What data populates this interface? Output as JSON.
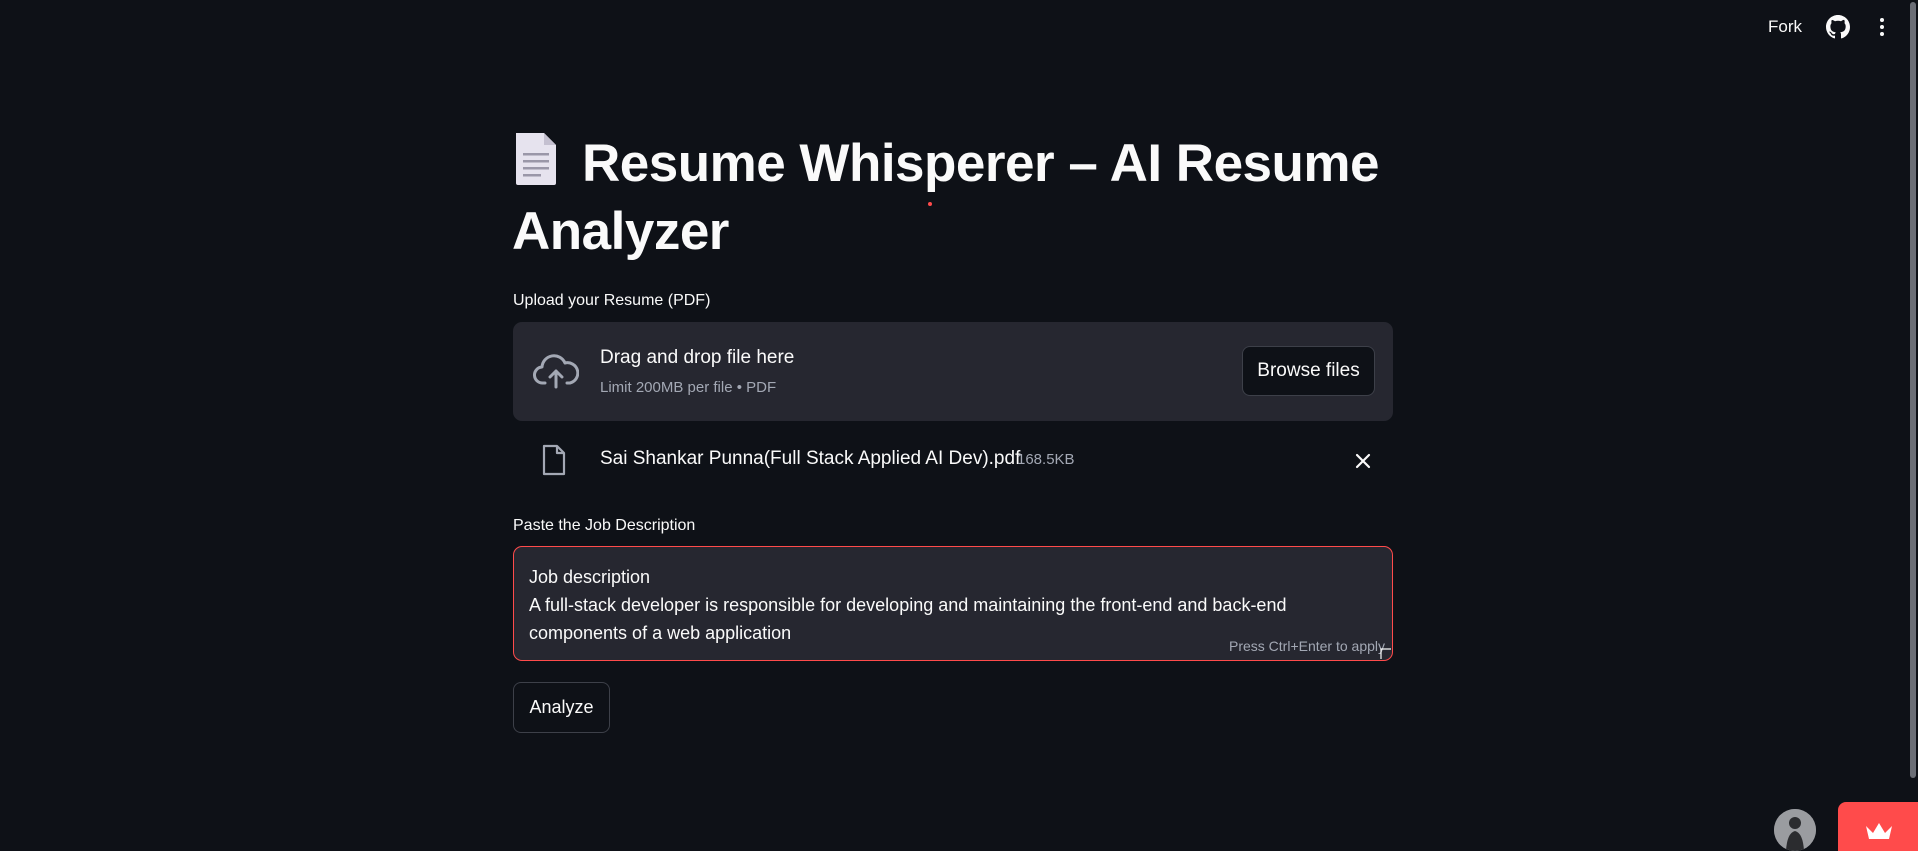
{
  "header": {
    "fork_label": "Fork",
    "github_icon": "github-icon",
    "menu_icon": "more-vertical-icon"
  },
  "title": {
    "icon": "page-facing-up-icon",
    "text": "Resume Whisperer – AI Resume Analyzer"
  },
  "uploader": {
    "label": "Upload your Resume (PDF)",
    "icon": "cloud-upload-icon",
    "instruction": "Drag and drop file here",
    "limit_text": "Limit 200MB per file • PDF",
    "browse_label": "Browse files",
    "uploaded_file": {
      "icon": "file-icon",
      "name": "Sai Shankar Punna(Full Stack Applied AI Dev).pdf",
      "size": "168.5KB",
      "remove_icon": "close-icon"
    }
  },
  "job_description": {
    "label": "Paste the Job Description",
    "value_lines": [
      "Job description",
      "A full-stack developer is responsible for developing and maintaining the front-end and back-end",
      "components of a web application"
    ],
    "hint": "Press Ctrl+Enter to apply"
  },
  "actions": {
    "analyze_label": "Analyze"
  },
  "footer": {
    "avatar_icon": "user-avatar",
    "badge_icon": "crown-icon"
  },
  "colors": {
    "background": "#0e1117",
    "surface": "#262730",
    "accent": "#ff4b4b",
    "text": "#fafafa",
    "muted_text": "#a3a8b4"
  }
}
